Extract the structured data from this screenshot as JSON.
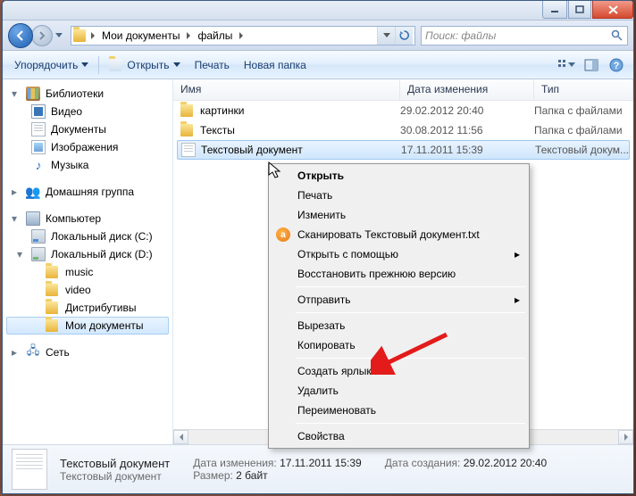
{
  "window": {
    "titlebar": {
      "min": "–",
      "max": "□",
      "close": "✕"
    }
  },
  "nav": {
    "breadcrumbs": [
      "Мои документы",
      "файлы"
    ],
    "search_placeholder": "Поиск: файлы"
  },
  "toolbar": {
    "organize": "Упорядочить",
    "open": "Открыть",
    "print": "Печать",
    "new_folder": "Новая папка"
  },
  "sidebar": {
    "libraries": {
      "label": "Библиотеки",
      "items": [
        "Видео",
        "Документы",
        "Изображения",
        "Музыка"
      ]
    },
    "homegroup": "Домашняя группа",
    "computer": {
      "label": "Компьютер",
      "drives": [
        "Локальный диск (C:)",
        "Локальный диск (D:)"
      ],
      "folders": [
        "music",
        "video",
        "Дистрибутивы",
        "Мои документы"
      ]
    },
    "network": "Сеть"
  },
  "columns": {
    "name": "Имя",
    "date": "Дата изменения",
    "type": "Тип"
  },
  "files": [
    {
      "name": "картинки",
      "date": "29.02.2012 20:40",
      "type": "Папка с файлами",
      "kind": "folder"
    },
    {
      "name": "Тексты",
      "date": "30.08.2012 11:56",
      "type": "Папка с файлами",
      "kind": "folder"
    },
    {
      "name": "Текстовый документ",
      "date": "17.11.2011 15:39",
      "type": "Текстовый докум...",
      "kind": "txt",
      "selected": true
    }
  ],
  "context_menu": {
    "open": "Открыть",
    "print": "Печать",
    "edit": "Изменить",
    "scan": "Сканировать Текстовый документ.txt",
    "open_with": "Открыть с помощью",
    "restore": "Восстановить прежнюю версию",
    "send_to": "Отправить",
    "cut": "Вырезать",
    "copy": "Копировать",
    "shortcut": "Создать ярлык",
    "delete": "Удалить",
    "rename": "Переименовать",
    "properties": "Свойства"
  },
  "details": {
    "title": "Текстовый документ",
    "subtitle": "Текстовый документ",
    "date_mod_label": "Дата изменения:",
    "date_mod": "17.11.2011 15:39",
    "date_created_label": "Дата создания:",
    "date_created": "29.02.2012 20:40",
    "size_label": "Размер:",
    "size": "2 байт"
  }
}
